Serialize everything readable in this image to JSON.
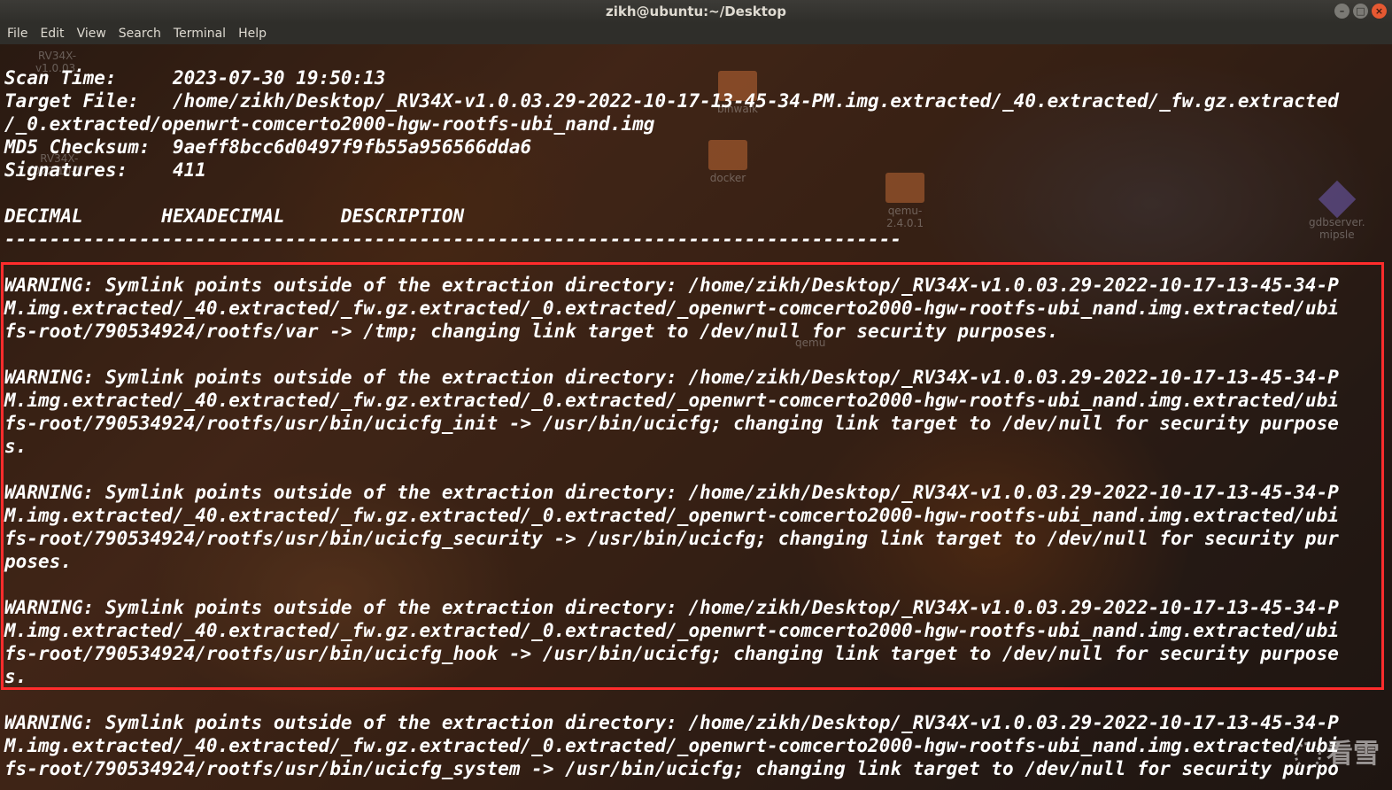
{
  "window": {
    "title": "zikh@ubuntu:~/Desktop",
    "controls": [
      "minimize",
      "maximize",
      "close"
    ]
  },
  "menu": {
    "items": [
      "File",
      "Edit",
      "View",
      "Search",
      "Terminal",
      "Help"
    ]
  },
  "desktop_ghosts": {
    "rv34x_1": "RV34X-",
    "rv34x_1b": "v1.0.03.",
    "rv34x_2": "RV34X-",
    "rv34x_2b": "2022-10-1...",
    "binwalk": "binwalk",
    "docker": "docker",
    "qemu_folder": "qemu-",
    "qemu_folder_b": "2.4.0.1",
    "gdbserver": "gdbserver.",
    "gdbserver_b": "mipsle",
    "qemu": "qemu"
  },
  "terminal": {
    "header": [
      "Scan Time:     2023-07-30 19:50:13",
      "Target File:   /home/zikh/Desktop/_RV34X-v1.0.03.29-2022-10-17-13-45-34-PM.img.extracted/_40.extracted/_fw.gz.extracted",
      "/_0.extracted/openwrt-comcerto2000-hgw-rootfs-ubi_nand.img",
      "MD5 Checksum:  9aeff8bcc6d0497f9fb55a956566dda6",
      "Signatures:    411",
      "",
      "DECIMAL       HEXADECIMAL     DESCRIPTION",
      "--------------------------------------------------------------------------------",
      ""
    ],
    "highlighted": [
      "WARNING: Symlink points outside of the extraction directory: /home/zikh/Desktop/_RV34X-v1.0.03.29-2022-10-17-13-45-34-P",
      "M.img.extracted/_40.extracted/_fw.gz.extracted/_0.extracted/_openwrt-comcerto2000-hgw-rootfs-ubi_nand.img.extracted/ubi",
      "fs-root/790534924/rootfs/var -> /tmp; changing link target to /dev/null for security purposes.",
      "",
      "WARNING: Symlink points outside of the extraction directory: /home/zikh/Desktop/_RV34X-v1.0.03.29-2022-10-17-13-45-34-P",
      "M.img.extracted/_40.extracted/_fw.gz.extracted/_0.extracted/_openwrt-comcerto2000-hgw-rootfs-ubi_nand.img.extracted/ubi",
      "fs-root/790534924/rootfs/usr/bin/ucicfg_init -> /usr/bin/ucicfg; changing link target to /dev/null for security purpose",
      "s.",
      "",
      "WARNING: Symlink points outside of the extraction directory: /home/zikh/Desktop/_RV34X-v1.0.03.29-2022-10-17-13-45-34-P",
      "M.img.extracted/_40.extracted/_fw.gz.extracted/_0.extracted/_openwrt-comcerto2000-hgw-rootfs-ubi_nand.img.extracted/ubi",
      "fs-root/790534924/rootfs/usr/bin/ucicfg_security -> /usr/bin/ucicfg; changing link target to /dev/null for security pur",
      "poses.",
      "",
      "WARNING: Symlink points outside of the extraction directory: /home/zikh/Desktop/_RV34X-v1.0.03.29-2022-10-17-13-45-34-P",
      "M.img.extracted/_40.extracted/_fw.gz.extracted/_0.extracted/_openwrt-comcerto2000-hgw-rootfs-ubi_nand.img.extracted/ubi",
      "fs-root/790534924/rootfs/usr/bin/ucicfg_hook -> /usr/bin/ucicfg; changing link target to /dev/null for security purpose",
      "s.",
      ""
    ],
    "trailing": [
      "WARNING: Symlink points outside of the extraction directory: /home/zikh/Desktop/_RV34X-v1.0.03.29-2022-10-17-13-45-34-P",
      "M.img.extracted/_40.extracted/_fw.gz.extracted/_0.extracted/_openwrt-comcerto2000-hgw-rootfs-ubi_nand.img.extracted/ubi",
      "fs-root/790534924/rootfs/usr/bin/ucicfg_system -> /usr/bin/ucicfg; changing link target to /dev/null for security purpo"
    ]
  },
  "watermark": {
    "text": "看雪"
  },
  "colors": {
    "highlight_border": "#ff2c2c",
    "terminal_text": "#ffffff"
  }
}
